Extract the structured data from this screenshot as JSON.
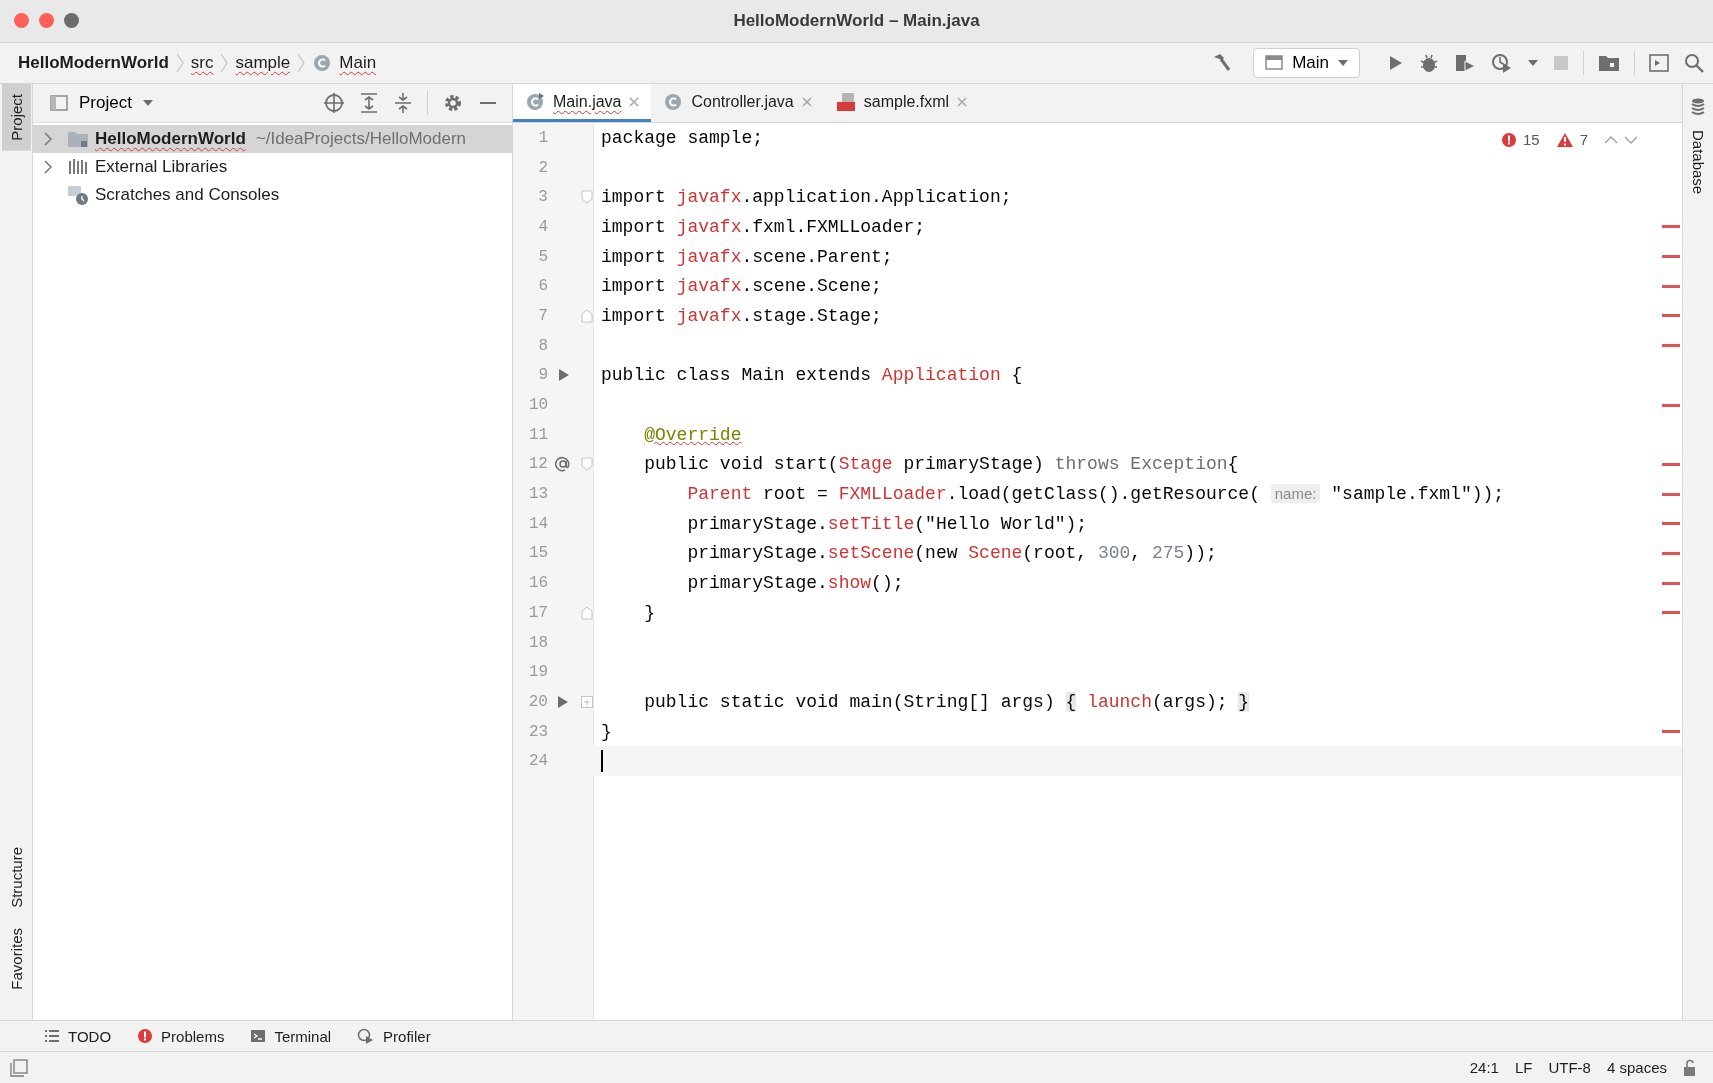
{
  "window": {
    "title": "HelloModernWorld – Main.java"
  },
  "breadcrumbs": [
    {
      "label": "HelloModernWorld",
      "kind": "project"
    },
    {
      "label": "src",
      "kind": "folder"
    },
    {
      "label": "sample",
      "kind": "folder"
    },
    {
      "label": "Main",
      "kind": "class"
    }
  ],
  "run_config": {
    "label": "Main"
  },
  "left_strip": [
    {
      "label": "Project",
      "selected": true
    },
    {
      "label": "Structure",
      "selected": false
    },
    {
      "label": "Favorites",
      "selected": false
    }
  ],
  "right_strip": [
    {
      "label": "Database",
      "selected": false
    }
  ],
  "project_panel": {
    "title": "Project",
    "tree": [
      {
        "label": "HelloModernWorld",
        "path": "~/IdeaProjects/HelloModern",
        "kind": "module",
        "expanded": false,
        "selected": true
      },
      {
        "label": "External Libraries",
        "kind": "libraries",
        "expanded": false,
        "selected": false
      },
      {
        "label": "Scratches and Consoles",
        "kind": "scratches",
        "selected": false
      }
    ]
  },
  "tabs": [
    {
      "label": "Main.java",
      "kind": "main-class",
      "selected": true
    },
    {
      "label": "Controller.java",
      "kind": "class",
      "selected": false
    },
    {
      "label": "sample.fxml",
      "kind": "fxml",
      "selected": false
    }
  ],
  "inspections": {
    "errors": "15",
    "warnings": "7"
  },
  "code_lines": [
    {
      "number": "1",
      "tokens": [
        {
          "kind": "plain",
          "text": "package sample;"
        }
      ]
    },
    {
      "number": "2"
    },
    {
      "number": "3",
      "fold_start": true,
      "tokens": [
        {
          "kind": "plain",
          "text": "import "
        },
        {
          "kind": "error",
          "text": "javafx"
        },
        {
          "kind": "plain",
          "text": ".application.Application;"
        }
      ]
    },
    {
      "number": "4",
      "stripe": true,
      "tokens": [
        {
          "kind": "plain",
          "text": "import "
        },
        {
          "kind": "error",
          "text": "javafx"
        },
        {
          "kind": "plain",
          "text": ".fxml.FXMLLoader;"
        }
      ]
    },
    {
      "number": "5",
      "stripe": true,
      "tokens": [
        {
          "kind": "plain",
          "text": "import "
        },
        {
          "kind": "error",
          "text": "javafx"
        },
        {
          "kind": "plain",
          "text": ".scene.Parent;"
        }
      ]
    },
    {
      "number": "6",
      "stripe": true,
      "tokens": [
        {
          "kind": "plain",
          "text": "import "
        },
        {
          "kind": "error",
          "text": "javafx"
        },
        {
          "kind": "plain",
          "text": ".scene.Scene;"
        }
      ]
    },
    {
      "number": "7",
      "stripe": true,
      "fold_end": true,
      "tokens": [
        {
          "kind": "plain",
          "text": "import "
        },
        {
          "kind": "error",
          "text": "javafx"
        },
        {
          "kind": "plain",
          "text": ".stage.Stage;"
        }
      ]
    },
    {
      "number": "8",
      "stripe": true
    },
    {
      "number": "9",
      "run_marker": true,
      "tokens": [
        {
          "kind": "plain",
          "text": "public class Main extends "
        },
        {
          "kind": "error",
          "text": "Application"
        },
        {
          "kind": "plain",
          "text": " {"
        }
      ]
    },
    {
      "number": "10",
      "stripe": true
    },
    {
      "number": "11",
      "tokens": [
        {
          "kind": "annotation",
          "text": "    @Override"
        }
      ]
    },
    {
      "number": "12",
      "override_marker": true,
      "fold_start": true,
      "stripe": true,
      "tokens": [
        {
          "kind": "plain",
          "text": "    public void start("
        },
        {
          "kind": "error",
          "text": "Stage"
        },
        {
          "kind": "plain",
          "text": " primaryStage) "
        },
        {
          "kind": "muted",
          "text": "throws Exception"
        },
        {
          "kind": "plain",
          "text": "{"
        }
      ]
    },
    {
      "number": "13",
      "stripe": true,
      "tokens": [
        {
          "kind": "error",
          "text": "        Parent"
        },
        {
          "kind": "plain",
          "text": " root = "
        },
        {
          "kind": "error",
          "text": "FXMLLoader"
        },
        {
          "kind": "plain",
          "text": ".load(getClass().getResource( "
        },
        {
          "kind": "hint",
          "text": "name:"
        },
        {
          "kind": "plain",
          "text": " \"sample.fxml\"));"
        }
      ]
    },
    {
      "number": "14",
      "stripe": true,
      "tokens": [
        {
          "kind": "plain",
          "text": "        primaryStage."
        },
        {
          "kind": "error",
          "text": "setTitle"
        },
        {
          "kind": "plain",
          "text": "(\"Hello World\");"
        }
      ]
    },
    {
      "number": "15",
      "stripe": true,
      "tokens": [
        {
          "kind": "plain",
          "text": "        primaryStage."
        },
        {
          "kind": "error",
          "text": "setScene"
        },
        {
          "kind": "plain",
          "text": "(new "
        },
        {
          "kind": "error",
          "text": "Scene"
        },
        {
          "kind": "plain",
          "text": "(root, "
        },
        {
          "kind": "number",
          "text": "300"
        },
        {
          "kind": "plain",
          "text": ", "
        },
        {
          "kind": "number",
          "text": "275"
        },
        {
          "kind": "plain",
          "text": "));"
        }
      ]
    },
    {
      "number": "16",
      "stripe": true,
      "tokens": [
        {
          "kind": "plain",
          "text": "        primaryStage."
        },
        {
          "kind": "error",
          "text": "show"
        },
        {
          "kind": "plain",
          "text": "();"
        }
      ]
    },
    {
      "number": "17",
      "fold_end": true,
      "stripe": true,
      "tokens": [
        {
          "kind": "plain",
          "text": "    }"
        }
      ]
    },
    {
      "number": "18"
    },
    {
      "number": "19"
    },
    {
      "number": "20",
      "run_marker": true,
      "folded": true,
      "tokens": [
        {
          "kind": "plain",
          "text": "    public static void main(String[] args) "
        },
        {
          "kind": "brace",
          "text": "{"
        },
        {
          "kind": "error",
          "text": " launch"
        },
        {
          "kind": "plain",
          "text": "(args); "
        },
        {
          "kind": "brace",
          "text": "}"
        }
      ]
    },
    {
      "number": "23",
      "stripe": true,
      "tokens": [
        {
          "kind": "plain",
          "text": "}"
        }
      ]
    },
    {
      "number": "24",
      "current": true
    }
  ],
  "tool_windows": [
    {
      "label": "TODO",
      "kind": "todo"
    },
    {
      "label": "Problems",
      "kind": "problems"
    },
    {
      "label": "Terminal",
      "kind": "terminal"
    },
    {
      "label": "Profiler",
      "kind": "profiler"
    }
  ],
  "status_bar": {
    "position": "24:1",
    "line_separator": "LF",
    "encoding": "UTF-8",
    "indent": "4 spaces"
  }
}
